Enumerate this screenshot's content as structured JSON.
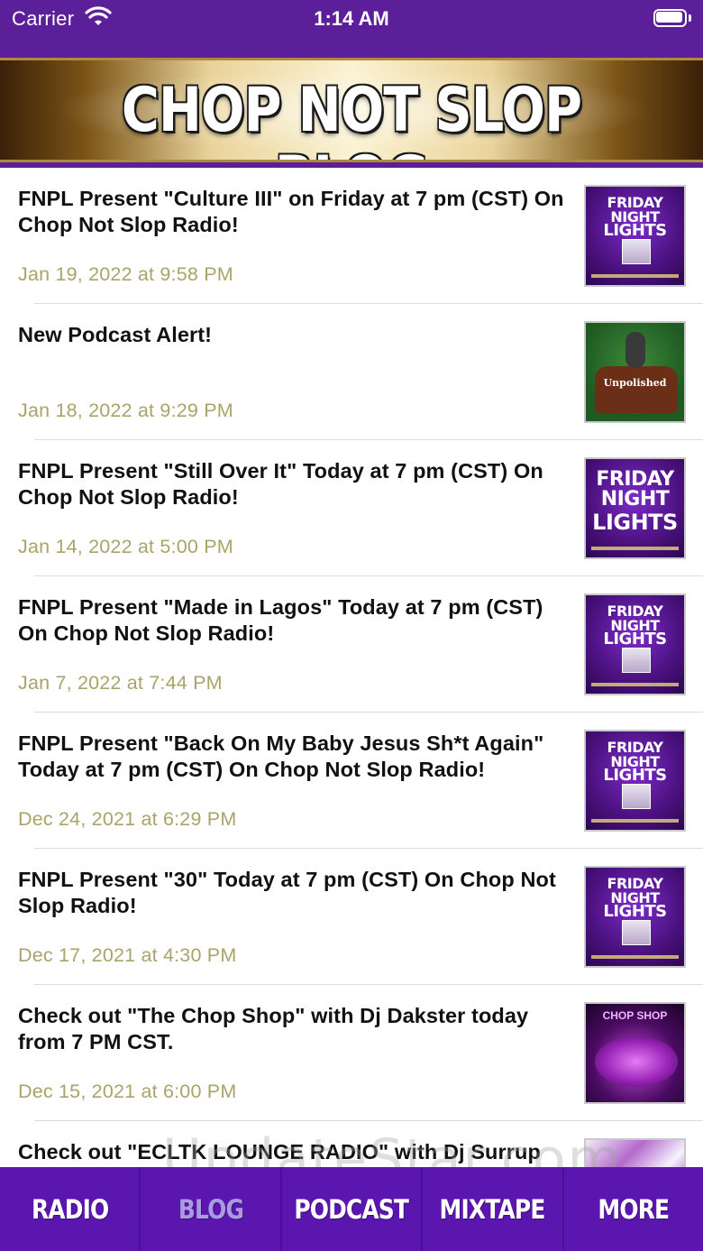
{
  "status_bar": {
    "carrier": "Carrier",
    "time": "1:14 AM",
    "wifi_icon": "wifi-icon",
    "battery_icon": "battery-icon"
  },
  "banner": {
    "title": "CHOP NOT SLOP BLOG"
  },
  "posts": [
    {
      "title": "FNPL Present \"Culture III\" on Friday at 7 pm (CST) On Chop Not Slop Radio!",
      "date": "Jan 19, 2022 at 9:58 PM",
      "thumb": {
        "style": "fnpl",
        "lines": [
          "FRIDAY",
          "NIGHT",
          "LIGHTS"
        ]
      }
    },
    {
      "title": "New Podcast Alert!",
      "date": "Jan 18, 2022 at 9:29 PM",
      "thumb": {
        "style": "podcast",
        "caption": "Unpolished"
      }
    },
    {
      "title": "FNPL Present \"Still Over It\" Today at 7 pm (CST) On Chop Not Slop Radio!",
      "date": "Jan 14, 2022 at 5:00 PM",
      "thumb": {
        "style": "fnpl-big",
        "lines": [
          "FRIDAY",
          "NIGHT",
          "LIGHTS"
        ]
      }
    },
    {
      "title": "FNPL Present \"Made in Lagos\" Today at 7 pm (CST) On Chop Not Slop Radio!",
      "date": "Jan 7, 2022 at 7:44 PM",
      "thumb": {
        "style": "fnpl",
        "lines": [
          "FRIDAY",
          "NIGHT",
          "LIGHTS"
        ]
      }
    },
    {
      "title": "FNPL Present \"Back On My Baby Jesus Sh*t Again\" Today at 7 pm (CST) On Chop Not Slop Radio!",
      "date": "Dec 24, 2021 at 6:29 PM",
      "thumb": {
        "style": "fnpl",
        "lines": [
          "FRIDAY",
          "NIGHT",
          "LIGHTS"
        ]
      }
    },
    {
      "title": "FNPL Present \"30\" Today at 7 pm (CST) On Chop Not Slop Radio!",
      "date": "Dec 17, 2021 at 4:30 PM",
      "thumb": {
        "style": "fnpl",
        "lines": [
          "FRIDAY",
          "NIGHT",
          "LIGHTS"
        ]
      }
    },
    {
      "title": "Check out \"The Chop Shop\" with Dj Dakster today from 7 PM CST.",
      "date": "Dec 15, 2021 at 6:00 PM",
      "thumb": {
        "style": "mixtape",
        "caption": "CHOP SHOP"
      }
    },
    {
      "title": "Check out \"ECLTK LOUNGE RADIO\" with Dj Surrup",
      "date": "",
      "thumb": {
        "style": "abstract"
      }
    }
  ],
  "watermark": "UpdateStar.com",
  "tabs": [
    {
      "label": "RADIO",
      "active": false
    },
    {
      "label": "BLOG",
      "active": true
    },
    {
      "label": "PODCAST",
      "active": false
    },
    {
      "label": "MIXTAPE",
      "active": false
    },
    {
      "label": "MORE",
      "active": false
    }
  ],
  "colors": {
    "brand_purple": "#5b1f9a",
    "tab_bar": "#5b16b0",
    "date_text": "#a8a46a",
    "active_tab_text": "#a99ae2"
  }
}
